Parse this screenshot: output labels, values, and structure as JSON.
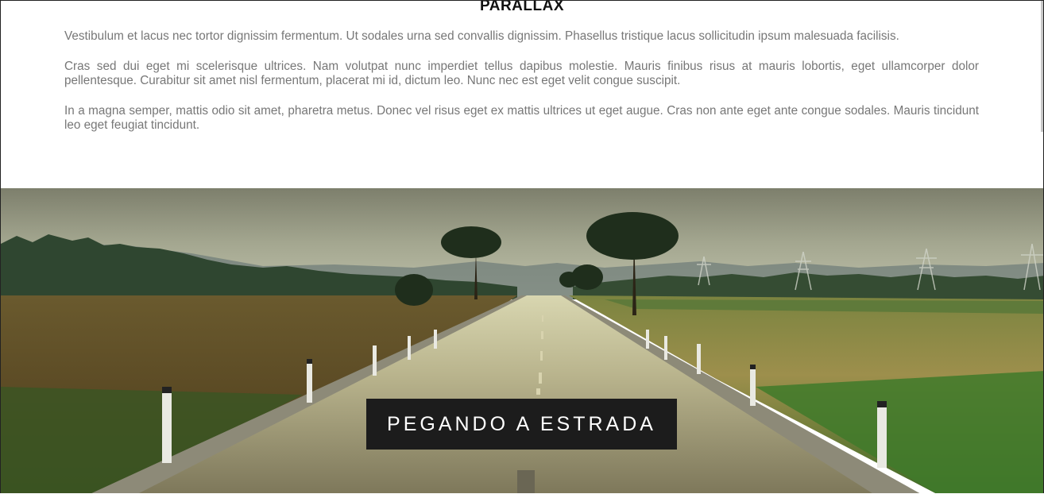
{
  "section": {
    "heading": "PARALLAX",
    "paragraphs": [
      "Vestibulum et lacus nec tortor dignissim fermentum. Ut sodales urna sed convallis dignissim. Phasellus tristique lacus sollicitudin ipsum malesuada facilisis.",
      "Cras sed dui eget mi scelerisque ultrices. Nam volutpat nunc imperdiet tellus dapibus molestie. Mauris finibus risus at mauris lobortis, eget ullamcorper dolor pellentesque. Curabitur sit amet nisl fermentum, placerat mi id, dictum leo. Nunc nec est eget velit congue suscipit.",
      "In a magna semper, mattis odio sit amet, pharetra metus. Donec vel risus eget ex mattis ultrices ut eget augue. Cras non ante eget ante congue sodales. Mauris tincidunt leo eget feugiat tincidunt."
    ]
  },
  "parallax": {
    "banner_text": "PEGANDO A ESTRADA"
  },
  "colors": {
    "text": "#777777",
    "banner_bg": "#1c1c1c",
    "banner_text": "#ffffff"
  }
}
